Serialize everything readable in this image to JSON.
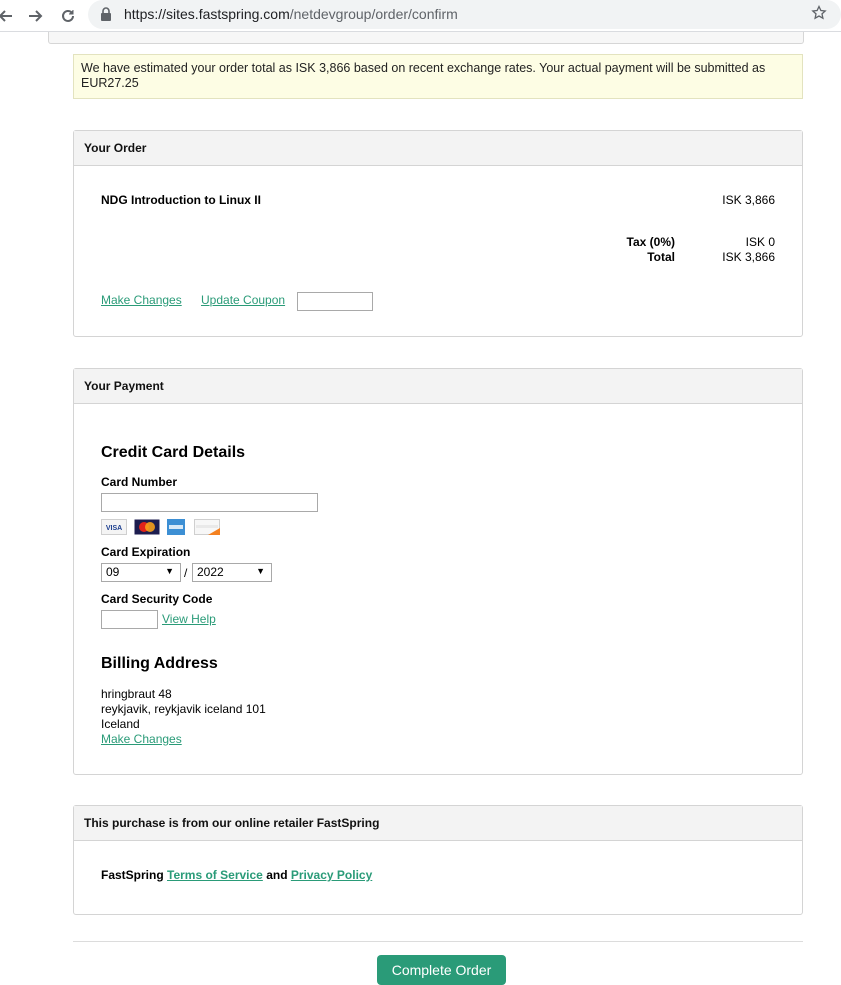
{
  "browser": {
    "url_host": "https://sites.fastspring.com",
    "url_path": "/netdevgroup/order/confirm"
  },
  "notice": {
    "text": "We have estimated your order total as ISK 3,866 based on recent exchange rates. Your actual payment will be submitted as EUR27.25"
  },
  "order": {
    "title": "Your Order",
    "product_name": "NDG Introduction to Linux II",
    "product_price": "ISK 3,866",
    "tax_label": "Tax (0%)",
    "tax_value": "ISK 0",
    "total_label": "Total",
    "total_value": "ISK 3,866",
    "make_changes": "Make Changes",
    "update_coupon": "Update Coupon",
    "coupon_value": ""
  },
  "payment": {
    "title": "Your Payment",
    "cc_heading": "Credit Card Details",
    "card_number_label": "Card Number",
    "card_number_value": "",
    "card_logos": [
      "visa",
      "mastercard",
      "amex",
      "discover"
    ],
    "expiration_label": "Card Expiration",
    "exp_month": "09",
    "exp_separator": "/",
    "exp_year": "2022",
    "security_code_label": "Card Security Code",
    "security_code_value": "",
    "view_help": "View Help",
    "billing_heading": "Billing Address",
    "billing_line1": "hringbraut 48",
    "billing_line2": "reykjavik, reykjavik iceland 101",
    "billing_line3": "Iceland",
    "billing_make_changes": "Make Changes"
  },
  "retailer": {
    "title": "This purchase is from our online retailer FastSpring",
    "prefix": "FastSpring",
    "terms": "Terms of Service",
    "and": "and",
    "privacy": "Privacy Policy"
  },
  "complete_order": "Complete Order",
  "colors": {
    "accent": "#2a9b78",
    "notice_bg": "#fdfde4",
    "panel_head_bg": "#f3f3f3"
  }
}
